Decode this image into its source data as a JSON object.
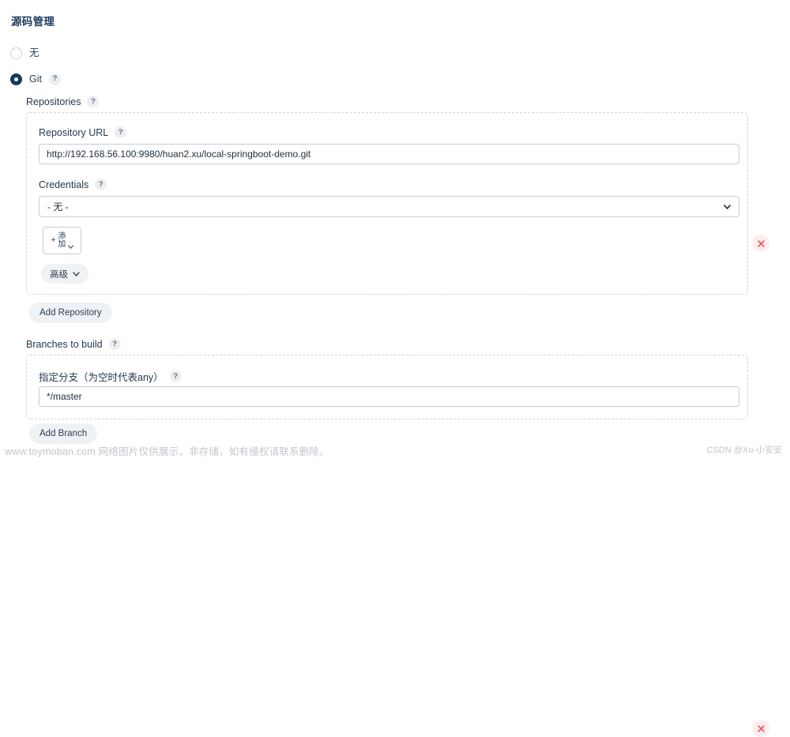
{
  "section": {
    "title": "源码管理"
  },
  "scm_options": [
    {
      "label": "无",
      "selected": false,
      "has_help": false
    },
    {
      "label": "Git",
      "selected": true,
      "has_help": true
    }
  ],
  "repositories": {
    "label": "Repositories",
    "help": "?",
    "repo_url": {
      "label": "Repository URL",
      "help": "?",
      "value": "http://192.168.56.100:9980/huan2.xu/local-springboot-demo.git"
    },
    "credentials": {
      "label": "Credentials",
      "help": "?",
      "selected": "- 无 -",
      "add_button": {
        "plus": "+",
        "label": "添加"
      }
    },
    "advanced_button": "高级",
    "delete_title": "×"
  },
  "add_repository_button": "Add Repository",
  "branches": {
    "label": "Branches to build",
    "help": "?",
    "branch_spec": {
      "label": "指定分支（为空时代表any）",
      "help": "?",
      "value": "*/master"
    },
    "delete_title": "×"
  },
  "add_branch_button": "Add Branch",
  "watermarks": {
    "left": "www.toymoban.com 网络图片仅供展示，非存储，如有侵权请联系删除。",
    "right": "CSDN @Xu-小安安"
  },
  "colors": {
    "title": "#1c3a5e",
    "radio_selected": "#14395c",
    "delete_red": "#ef4e52",
    "delete_bg": "#fdeeee",
    "dashed_border": "#cfd6dd",
    "input_border": "#c5ccd6",
    "pill_bg": "#f0f1f4",
    "watermark": "#c2c6cb"
  }
}
